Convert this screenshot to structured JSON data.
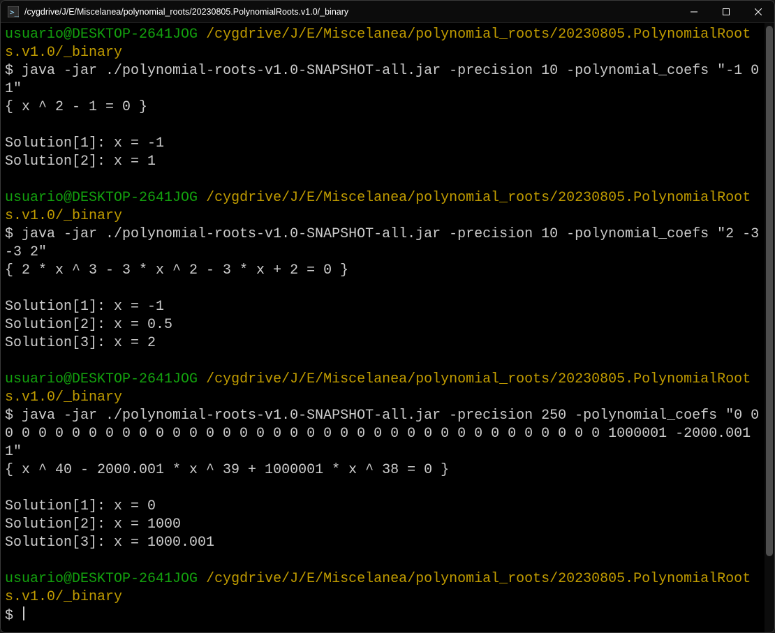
{
  "titlebar": {
    "title": "/cygdrive/J/E/Miscelanea/polynomial_roots/20230805.PolynomialRoots.v1.0/_binary"
  },
  "prompt": {
    "user_host": "usuario@DESKTOP-2641JOG",
    "cwd": "/cygdrive/J/E/Miscelanea/polynomial_roots/20230805.PolynomialRoots.v1.0/_binary",
    "symbol": "$ "
  },
  "blocks": [
    {
      "command": "java -jar ./polynomial-roots-v1.0-SNAPSHOT-all.jar -precision 10 -polynomial_coefs \"-1 0 1\"",
      "equation": "{ x ^ 2 - 1 = 0 }",
      "solutions": [
        "Solution[1]: x = -1",
        "Solution[2]: x = 1"
      ]
    },
    {
      "command": "java -jar ./polynomial-roots-v1.0-SNAPSHOT-all.jar -precision 10 -polynomial_coefs \"2 -3 -3 2\"",
      "equation": "{ 2 * x ^ 3 - 3 * x ^ 2 - 3 * x + 2 = 0 }",
      "solutions": [
        "Solution[1]: x = -1",
        "Solution[2]: x = 0.5",
        "Solution[3]: x = 2"
      ]
    },
    {
      "command": "java -jar ./polynomial-roots-v1.0-SNAPSHOT-all.jar -precision 250 -polynomial_coefs \"0 0 0 0 0 0 0 0 0 0 0 0 0 0 0 0 0 0 0 0 0 0 0 0 0 0 0 0 0 0 0 0 0 0 0 0 0 0 1000001 -2000.001 1\"",
      "equation": "{ x ^ 40 - 2000.001 * x ^ 39 + 1000001 * x ^ 38 = 0 }",
      "solutions": [
        "Solution[1]: x = 0",
        "Solution[2]: x = 1000",
        "Solution[3]: x = 1000.001"
      ]
    }
  ]
}
